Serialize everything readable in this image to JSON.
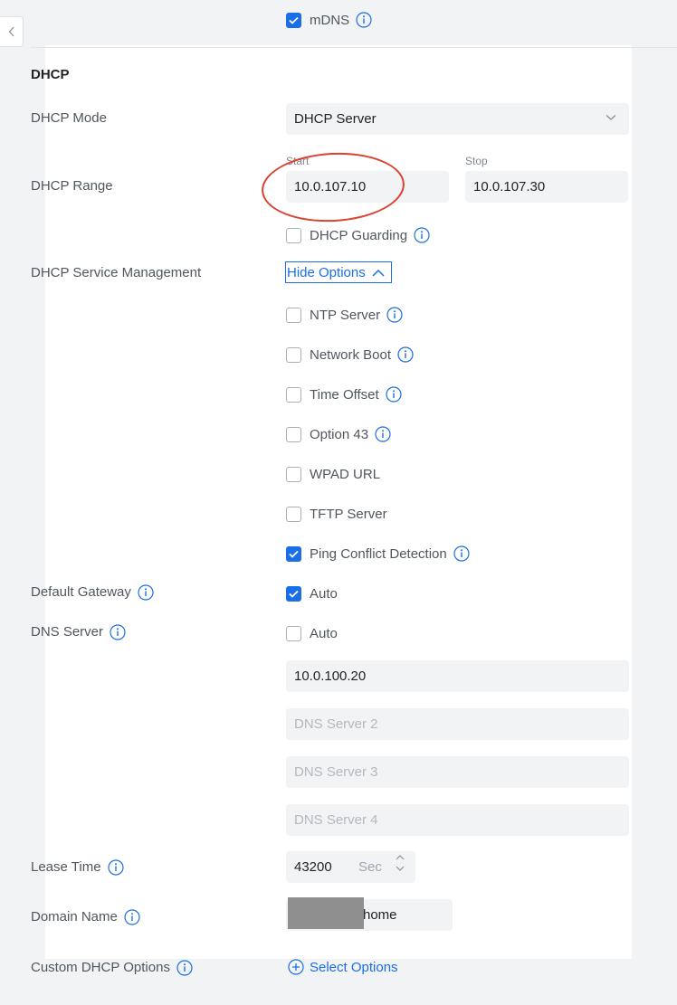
{
  "mdns": {
    "label": "mDNS",
    "checked": true
  },
  "dhcp": {
    "section_title": "DHCP",
    "mode": {
      "label": "DHCP Mode",
      "value": "DHCP Server"
    },
    "range": {
      "label": "DHCP Range",
      "start_caption": "Start",
      "start_value": "10.0.107.10",
      "stop_caption": "Stop",
      "stop_value": "10.0.107.30"
    },
    "guarding": {
      "label": "DHCP Guarding",
      "checked": false
    },
    "service_management": {
      "label": "DHCP Service Management",
      "toggle_label": "Hide Options",
      "options": [
        {
          "label": "NTP Server",
          "checked": false
        },
        {
          "label": "Network Boot",
          "checked": false
        },
        {
          "label": "Time Offset",
          "checked": false
        },
        {
          "label": "Option 43",
          "checked": false
        },
        {
          "label": "WPAD URL",
          "checked": false
        },
        {
          "label": "TFTP Server",
          "checked": false
        },
        {
          "label": "Ping Conflict Detection",
          "checked": true
        }
      ]
    },
    "default_gateway": {
      "label": "Default Gateway",
      "auto_label": "Auto",
      "auto_checked": true
    },
    "dns_server": {
      "label": "DNS Server",
      "auto_label": "Auto",
      "auto_checked": false,
      "server1_value": "10.0.100.20",
      "server2_placeholder": "DNS Server 2",
      "server3_placeholder": "DNS Server 3",
      "server4_placeholder": "DNS Server 4"
    },
    "lease_time": {
      "label": "Lease Time",
      "value": "43200",
      "unit": "Sec"
    },
    "domain_name": {
      "label": "Domain Name",
      "value": "home"
    },
    "custom_options": {
      "label": "Custom DHCP Options",
      "action_label": "Select Options"
    }
  },
  "colors": {
    "accent": "#1a6ee8",
    "annotation": "#d9432f"
  }
}
